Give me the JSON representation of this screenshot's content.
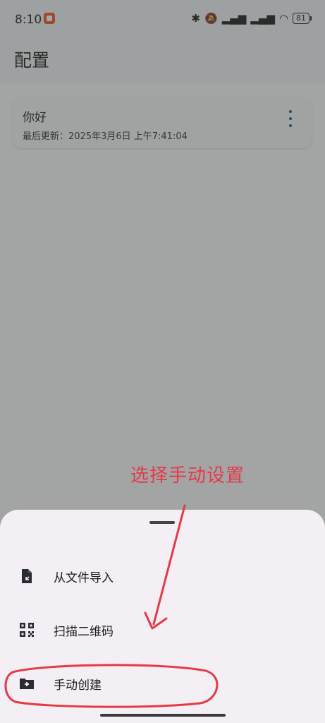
{
  "status_bar": {
    "time": "8:10",
    "battery": "81"
  },
  "header": {
    "title": "配置"
  },
  "card": {
    "title": "你好",
    "subtitle": "最后更新：2025年3月6日 上午7:41:04",
    "more_icon": "more-vert-icon"
  },
  "annotation": {
    "text": "选择手动设置",
    "color": "#e63946"
  },
  "sheet": {
    "items": [
      {
        "label": "从文件导入",
        "icon": "file-import-icon"
      },
      {
        "label": "扫描二维码",
        "icon": "qr-code-icon"
      },
      {
        "label": "手动创建",
        "icon": "folder-add-icon"
      }
    ]
  },
  "colors": {
    "accent": "#1d5c70",
    "sheet_bg": "#f4eff4"
  }
}
